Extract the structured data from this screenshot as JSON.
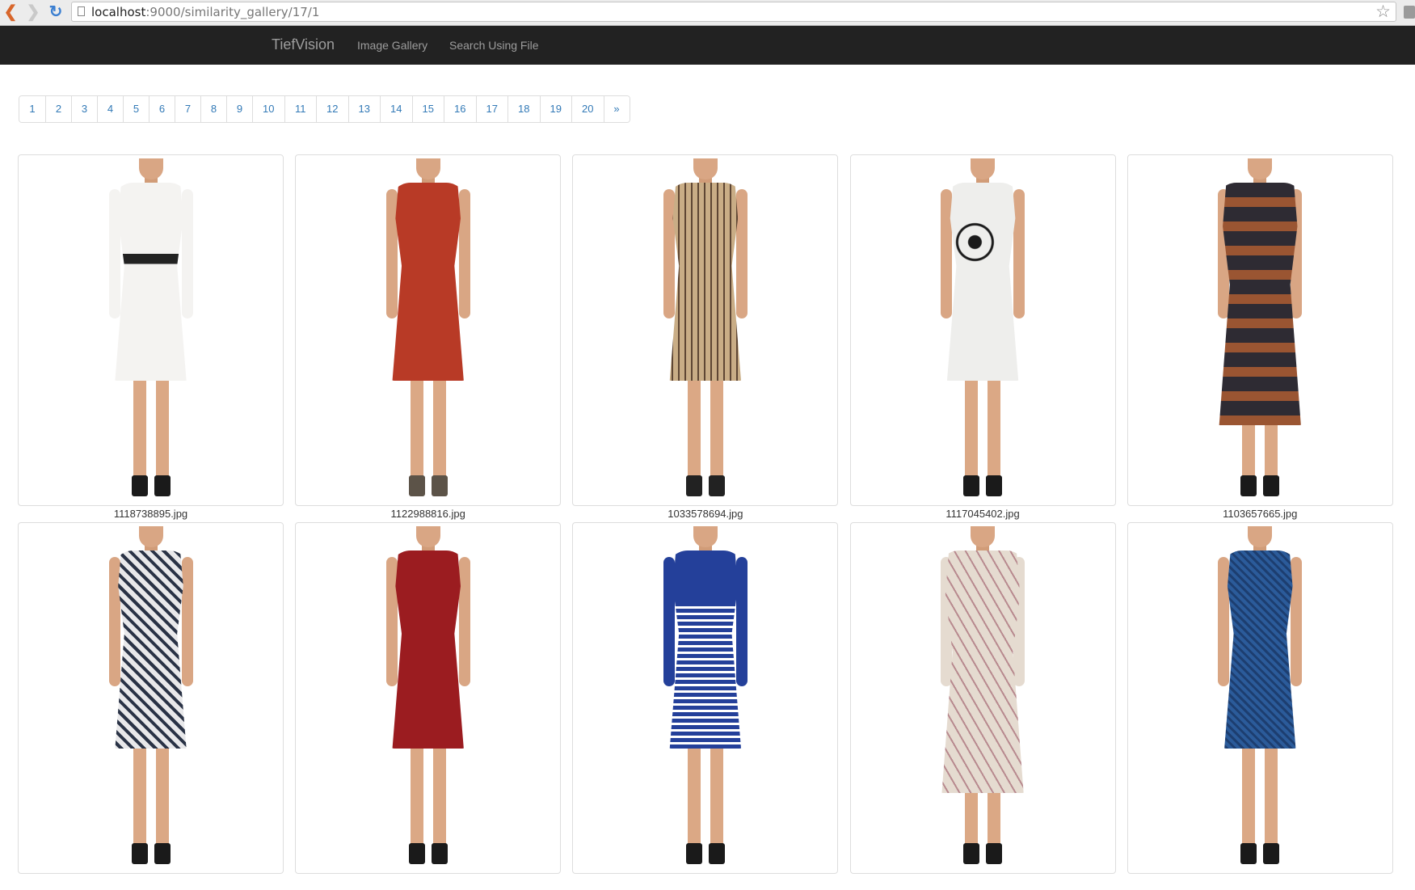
{
  "browser": {
    "url_host": "localhost",
    "url_path": ":9000/similarity_gallery/17/1"
  },
  "navbar": {
    "brand": "TiefVision",
    "links": [
      "Image Gallery",
      "Search Using File"
    ]
  },
  "pagination": {
    "pages": [
      "1",
      "2",
      "3",
      "4",
      "5",
      "6",
      "7",
      "8",
      "9",
      "10",
      "11",
      "12",
      "13",
      "14",
      "15",
      "16",
      "17",
      "18",
      "19",
      "20"
    ],
    "next_label": "»"
  },
  "gallery": {
    "items": [
      {
        "caption": "1118738895.jpg",
        "dress": "white long-sleeve dress with black waistband",
        "color": "#f4f3f1",
        "accent": "#222222",
        "shoe": "#1a1a1a"
      },
      {
        "caption": "1122988816.jpg",
        "dress": "red sleeveless sheath dress",
        "color": "#b83a26",
        "accent": "#a4321f",
        "shoe": "#5c5348"
      },
      {
        "caption": "1033578694.jpg",
        "dress": "beige patterned sleeveless dress",
        "color": "#c9ad86",
        "accent": "#5e4634",
        "shoe": "#222222"
      },
      {
        "caption": "1117045402.jpg",
        "dress": "white dress with black floral print",
        "color": "#eeeeec",
        "accent": "#1b1b1b",
        "shoe": "#1a1a1a"
      },
      {
        "caption": "1103657665.jpg",
        "dress": "dark striped midi dress",
        "color": "#2e2b33",
        "accent": "#9a5532",
        "shoe": "#1a1a1a"
      },
      {
        "caption": "",
        "dress": "navy and white palm print dress",
        "color": "#e8e8ea",
        "accent": "#2a3346",
        "shoe": "#1a1a1a"
      },
      {
        "caption": "",
        "dress": "dark red short-sleeve dress",
        "color": "#9b1c20",
        "accent": "#7a1519",
        "shoe": "#1a1a1a"
      },
      {
        "caption": "",
        "dress": "blue and white striped dress",
        "color": "#24409a",
        "accent": "#ffffff",
        "shoe": "#1a1a1a"
      },
      {
        "caption": "",
        "dress": "cream printed maxi dress",
        "color": "#e5dbd0",
        "accent": "#b88a8f",
        "shoe": "#1a1a1a"
      },
      {
        "caption": "",
        "dress": "blue patterned v-neck dress",
        "color": "#2b5b9a",
        "accent": "#1d3e70",
        "shoe": "#1a1a1a"
      }
    ]
  }
}
